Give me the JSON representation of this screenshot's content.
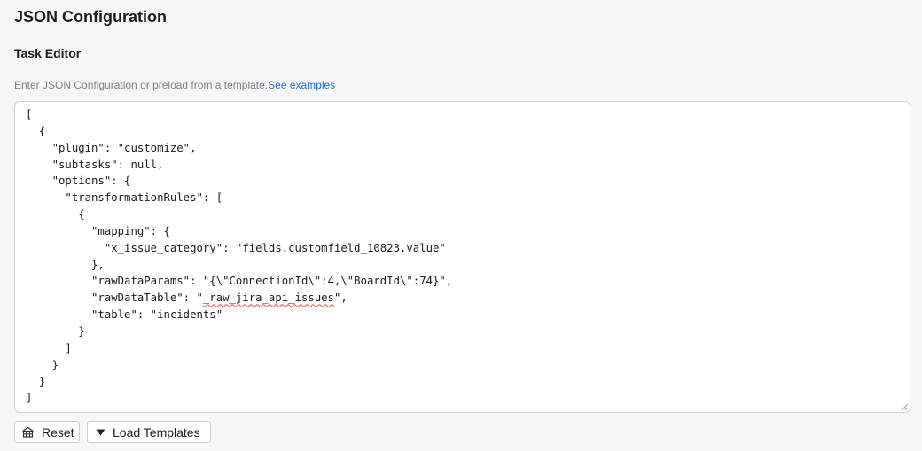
{
  "header": {
    "title": "JSON Configuration",
    "subtitle": "Task Editor"
  },
  "hint": {
    "text": "Enter JSON Configuration or preload from a template.",
    "link_label": "See examples"
  },
  "editor": {
    "lines": [
      "[",
      "  {",
      "    \"plugin\": \"customize\",",
      "    \"subtasks\": null,",
      "    \"options\": {",
      "      \"transformationRules\": [",
      "        {",
      "          \"mapping\": {",
      "            \"x_issue_category\": \"fields.customfield_10823.value\"",
      "          },",
      "          \"rawDataParams\": \"{\\\"ConnectionId\\\":4,\\\"BoardId\\\":74}\",",
      "          \"rawDataTable\": \"_raw_jira_api_issues\",",
      "          \"table\": \"incidents\"",
      "        }",
      "      ]",
      "    }",
      "  }",
      "]"
    ],
    "misspelled_word": "_raw_jira_api_issues"
  },
  "buttons": {
    "reset_label": "Reset",
    "reset_icon": "reset-icon",
    "load_templates_label": "Load Templates",
    "load_templates_icon": "caret-down-icon"
  },
  "colors": {
    "link": "#2f6bdc",
    "hint_text": "#7a7f87",
    "background": "#f6f6f6",
    "spellcheck_underline": "#e05050"
  }
}
